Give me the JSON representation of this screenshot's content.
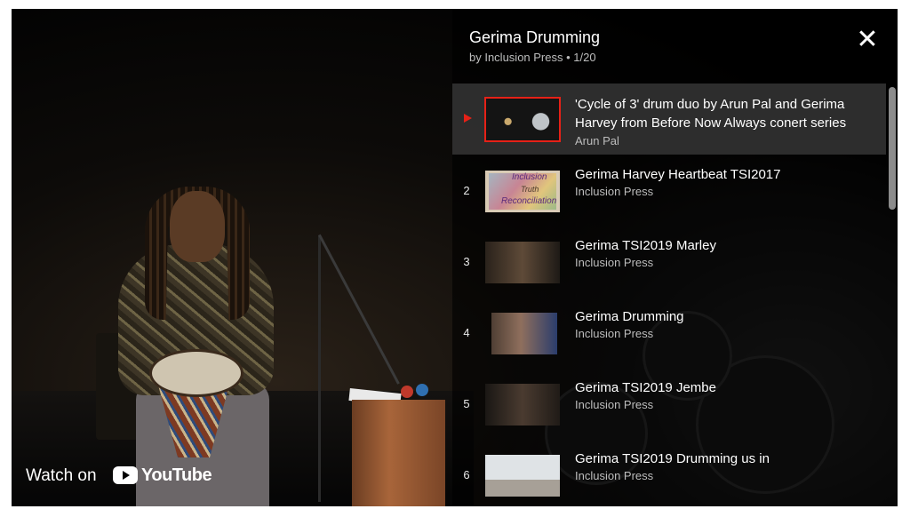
{
  "playlist": {
    "title": "Gerima Drumming",
    "subtitle": "by Inclusion Press • 1/20",
    "close_icon": "close-icon",
    "items": [
      {
        "index": "",
        "title": "'Cycle of 3' drum duo by Arun Pal and Gerima Harvey from Before Now Always conert series",
        "channel": "Arun Pal",
        "playing": true
      },
      {
        "index": "2",
        "title": "Gerima Harvey Heartbeat TSI2017",
        "channel": "Inclusion Press",
        "thumb_text": [
          "Inclusion",
          "Truth",
          "Reconciliation"
        ]
      },
      {
        "index": "3",
        "title": "Gerima TSI2019 Marley",
        "channel": "Inclusion Press"
      },
      {
        "index": "4",
        "title": "Gerima Drumming",
        "channel": "Inclusion Press"
      },
      {
        "index": "5",
        "title": "Gerima TSI2019 Jembe",
        "channel": "Inclusion Press"
      },
      {
        "index": "6",
        "title": "Gerima TSI2019 Drumming us in",
        "channel": "Inclusion Press"
      }
    ]
  },
  "watch_on": {
    "label": "Watch on",
    "brand": "YouTube",
    "icon": "youtube-logo-icon"
  },
  "colors": {
    "accent": "#e62117",
    "panel_bg": "rgba(0,0,0,0.62)",
    "active_row_bg": "#3c3c3c"
  }
}
